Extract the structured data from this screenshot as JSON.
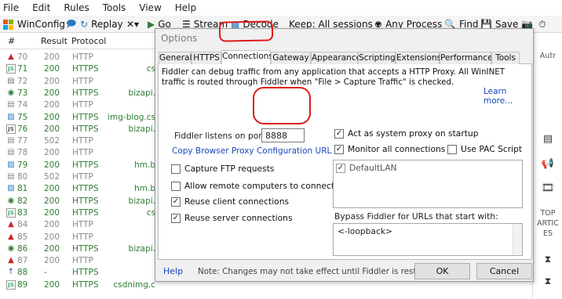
{
  "menu": [
    "File",
    "Edit",
    "Rules",
    "Tools",
    "View",
    "Help"
  ],
  "toolbar": {
    "winconfig": "WinConfig",
    "replay": "Replay",
    "remove": "✕▾",
    "go": "Go",
    "stream": "Stream",
    "decode": "Decode",
    "keep": "Keep: All sessions ▾",
    "any_process": "Any Process",
    "find": "Find",
    "save": "Save"
  },
  "session_headers": {
    "num": "#",
    "result": "Result",
    "protocol": "Protocol"
  },
  "sessions": [
    {
      "icon": "▲",
      "color": "#c62828",
      "num": "70",
      "result": "200",
      "protocol": "HTTP",
      "host": ""
    },
    {
      "icon": "JS",
      "color": "#3a6",
      "num": "71",
      "result": "200",
      "protocol": "HTTPS",
      "host": "cs"
    },
    {
      "icon": "▤",
      "color": "#777",
      "num": "72",
      "result": "200",
      "protocol": "HTTP",
      "host": ""
    },
    {
      "icon": "◉",
      "color": "#2e7d32",
      "num": "73",
      "result": "200",
      "protocol": "HTTPS",
      "host": "bizapi."
    },
    {
      "icon": "▤",
      "color": "#888",
      "num": "74",
      "result": "200",
      "protocol": "HTTP",
      "host": ""
    },
    {
      "icon": "▨",
      "color": "#2a7ac0",
      "num": "75",
      "result": "200",
      "protocol": "HTTPS",
      "host": "img-blog.cs"
    },
    {
      "icon": "JS",
      "color": "#555",
      "num": "76",
      "result": "200",
      "protocol": "HTTPS",
      "host": "bizapi."
    },
    {
      "icon": "▤",
      "color": "#888",
      "num": "77",
      "result": "502",
      "protocol": "HTTP",
      "host": ""
    },
    {
      "icon": "▤",
      "color": "#888",
      "num": "78",
      "result": "200",
      "protocol": "HTTP",
      "host": ""
    },
    {
      "icon": "▨",
      "color": "#2a7ac0",
      "num": "79",
      "result": "200",
      "protocol": "HTTPS",
      "host": "hm.b"
    },
    {
      "icon": "▤",
      "color": "#888",
      "num": "80",
      "result": "502",
      "protocol": "HTTP",
      "host": ""
    },
    {
      "icon": "▨",
      "color": "#2a7ac0",
      "num": "81",
      "result": "200",
      "protocol": "HTTPS",
      "host": "hm.b"
    },
    {
      "icon": "◉",
      "color": "#2e7d32",
      "num": "82",
      "result": "200",
      "protocol": "HTTPS",
      "host": "bizapi."
    },
    {
      "icon": "JS",
      "color": "#3a6",
      "num": "83",
      "result": "200",
      "protocol": "HTTPS",
      "host": "cs"
    },
    {
      "icon": "▲",
      "color": "#c62828",
      "num": "84",
      "result": "200",
      "protocol": "HTTP",
      "host": ""
    },
    {
      "icon": "▲",
      "color": "#c62828",
      "num": "85",
      "result": "200",
      "protocol": "HTTP",
      "host": ""
    },
    {
      "icon": "◉",
      "color": "#2e7d32",
      "num": "86",
      "result": "200",
      "protocol": "HTTPS",
      "host": "bizapi."
    },
    {
      "icon": "▲",
      "color": "#c62828",
      "num": "87",
      "result": "200",
      "protocol": "HTTP",
      "host": ""
    },
    {
      "icon": "↑",
      "color": "#1a46b8",
      "num": "88",
      "result": "-",
      "protocol": "HTTPS",
      "host": ""
    },
    {
      "icon": "JS",
      "color": "#3a6",
      "num": "89",
      "result": "200",
      "protocol": "HTTPS",
      "host": "csdnimg.c"
    }
  ],
  "right_strip": {
    "tab_label": "Autr",
    "top": "TOP",
    "artic": "ARTIC",
    "es": "ES"
  },
  "dialog": {
    "title": "Options",
    "tabs": [
      "General",
      "HTTPS",
      "Connections",
      "Gateway",
      "Appearance",
      "Scripting",
      "Extensions",
      "Performance",
      "Tools"
    ],
    "active_tab": "Connections",
    "description": "Fiddler can debug traffic from any application that accepts a HTTP Proxy. All WinINET traffic is routed through Fiddler when \"File > Capture Traffic\" is checked.",
    "learn_more": "Learn more...",
    "port_label": "Fiddler listens on port:",
    "port_value": "8888",
    "copy_proxy_link": "Copy Browser Proxy Configuration URL",
    "left_options": [
      {
        "label": "Capture FTP requests",
        "checked": false
      },
      {
        "label": "Allow remote computers to connect",
        "checked": false
      },
      {
        "label": "Reuse client connections",
        "checked": true
      },
      {
        "label": "Reuse server connections",
        "checked": true
      }
    ],
    "act_as_proxy": {
      "label": "Act as system proxy on startup",
      "checked": true
    },
    "monitor_all": {
      "label": "Monitor all connections",
      "checked": true
    },
    "use_pac": {
      "label": "Use PAC Script",
      "checked": false
    },
    "connections_list": [
      {
        "label": "DefaultLAN",
        "checked": true
      }
    ],
    "bypass_label": "Bypass Fiddler for URLs that start with:",
    "bypass_value": "<-loopback>",
    "help": "Help",
    "note": "Note: Changes may not take effect until Fiddler is restarted.",
    "ok": "OK",
    "cancel": "Cancel"
  },
  "colors": {
    "annotation_red": "#e01b1b",
    "link_blue": "#1a46b8",
    "https_green": "#2e7d32"
  }
}
